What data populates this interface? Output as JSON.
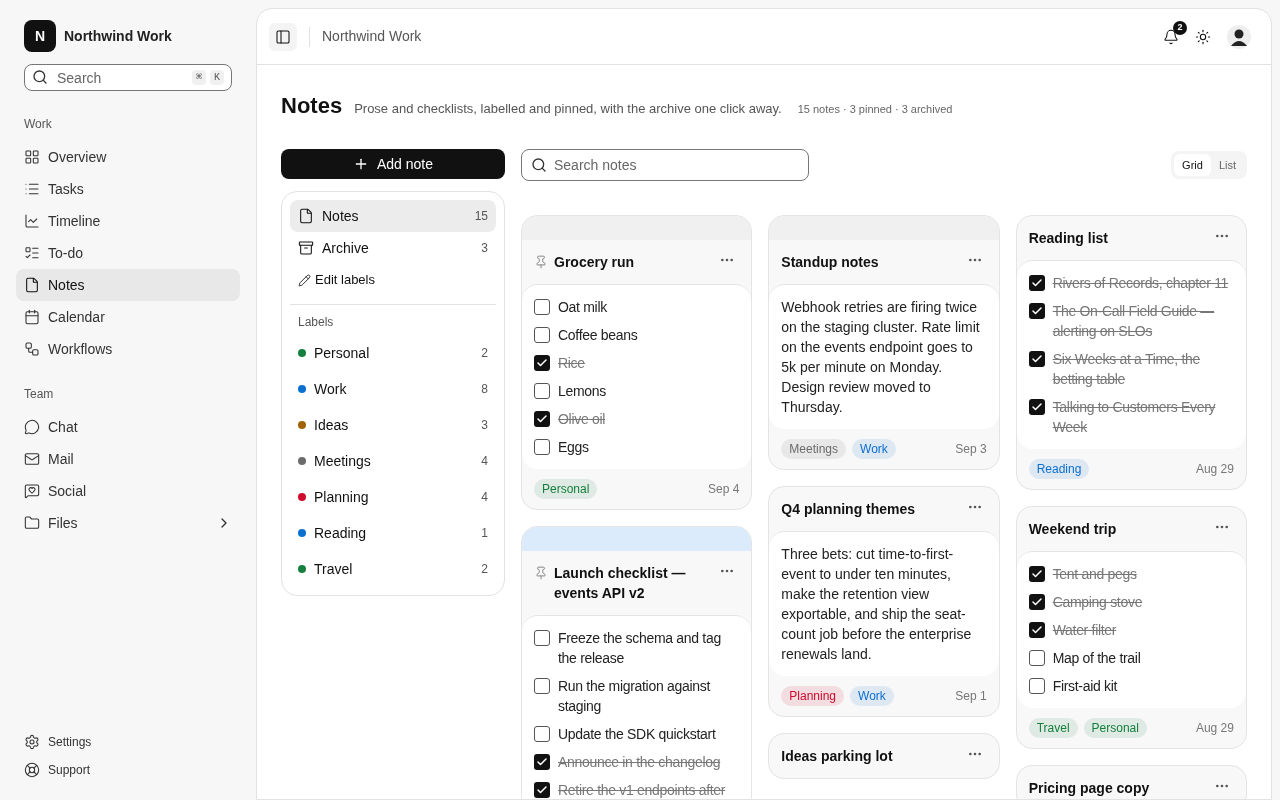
{
  "workspace": {
    "logo_letter": "N",
    "name": "Northwind Work"
  },
  "sidebar": {
    "search": {
      "placeholder": "Search",
      "shortcut": [
        "⌘",
        "K"
      ]
    },
    "sections": [
      {
        "title": "Work",
        "items": [
          {
            "label": "Overview",
            "selected": false
          },
          {
            "label": "Tasks",
            "selected": false
          },
          {
            "label": "Timeline",
            "selected": false
          },
          {
            "label": "To-do",
            "selected": false
          },
          {
            "label": "Notes",
            "selected": true
          },
          {
            "label": "Calendar",
            "selected": false
          },
          {
            "label": "Workflows",
            "selected": false
          }
        ]
      },
      {
        "title": "Team",
        "items": [
          {
            "label": "Chat",
            "selected": false
          },
          {
            "label": "Mail",
            "selected": false
          },
          {
            "label": "Social",
            "selected": false
          },
          {
            "label": "Files",
            "selected": false,
            "expanded": false
          }
        ]
      }
    ],
    "footer": [
      {
        "label": "Settings"
      },
      {
        "label": "Support"
      }
    ]
  },
  "header": {
    "breadcrumb": "Northwind Work",
    "notifications": "2"
  },
  "page": {
    "title": "Notes",
    "subtitle": "Prose and checklists, labelled and pinned, with the archive one click away.",
    "stats": "15 notes · 3 pinned · 3 archived"
  },
  "add_button": "Add note",
  "search": {
    "placeholder": "Search notes"
  },
  "view_toggle": [
    {
      "label": "Grid",
      "selected": true
    },
    {
      "label": "List",
      "selected": false
    }
  ],
  "filters": [
    {
      "label": "Notes",
      "count": "15",
      "selected": true
    },
    {
      "label": "Archive",
      "count": "3",
      "selected": false
    }
  ],
  "edit_labels": "Edit labels",
  "labels_title": "Labels",
  "labels": [
    {
      "name": "Personal",
      "count": "2",
      "color": "#15803d"
    },
    {
      "name": "Work",
      "count": "8",
      "color": "#0b6fd0"
    },
    {
      "name": "Ideas",
      "count": "3",
      "color": "#a16207"
    },
    {
      "name": "Meetings",
      "count": "4",
      "color": "#6b6b6b"
    },
    {
      "name": "Planning",
      "count": "4",
      "color": "#d00a2c"
    },
    {
      "name": "Reading",
      "count": "1",
      "color": "#0b6fd0"
    },
    {
      "name": "Travel",
      "count": "2",
      "color": "#15803d"
    }
  ],
  "columns": [
    [
      {
        "title": "Grocery run",
        "pinned": true,
        "color": "#f0f0f0",
        "kind": "checklist",
        "items": [
          {
            "text": "Oat milk",
            "checked": false
          },
          {
            "text": "Coffee beans",
            "checked": false
          },
          {
            "text": "Rice",
            "checked": true
          },
          {
            "text": "Lemons",
            "checked": false
          },
          {
            "text": "Olive oil",
            "checked": true
          },
          {
            "text": "Eggs",
            "checked": false
          }
        ],
        "tags": [
          {
            "label": "Personal",
            "color": "#15803d"
          }
        ],
        "date": "Sep 4"
      },
      {
        "title": "Launch checklist — events API v2",
        "pinned": true,
        "color": "#dcebfc",
        "kind": "checklist",
        "items": [
          {
            "text": "Freeze the schema and tag the release",
            "checked": false
          },
          {
            "text": "Run the migration against staging",
            "checked": false
          },
          {
            "text": "Update the SDK quickstart",
            "checked": false
          },
          {
            "text": "Announce in the changelog",
            "checked": true
          },
          {
            "text": "Retire the v1 endpoints after",
            "checked": true
          }
        ]
      }
    ],
    [
      {
        "title": "Standup notes",
        "pinned": false,
        "color": "#f0f0f0",
        "kind": "text",
        "text": "Webhook retries are firing twice on the staging cluster. Rate limit on the events endpoint goes to 5k per minute on Monday. Design review moved to Thursday.",
        "tags": [
          {
            "label": "Meetings",
            "color": "#6b6b6b"
          },
          {
            "label": "Work",
            "color": "#0b6fd0"
          }
        ],
        "date": "Sep 3"
      },
      {
        "title": "Q4 planning themes",
        "pinned": false,
        "kind": "text",
        "text": "Three bets: cut time-to-first-event to under ten minutes, make the retention view exportable, and ship the seat-count job before the enterprise renewals land.",
        "tags": [
          {
            "label": "Planning",
            "color": "#d00a2c"
          },
          {
            "label": "Work",
            "color": "#0b6fd0"
          }
        ],
        "date": "Sep 1"
      },
      {
        "title": "Ideas parking lot",
        "pinned": false
      }
    ],
    [
      {
        "title": "Reading list",
        "pinned": false,
        "kind": "checklist",
        "items": [
          {
            "text": "Rivers of Records, chapter 11",
            "checked": true
          },
          {
            "text": "The On-Call Field Guide — alerting on SLOs",
            "checked": true
          },
          {
            "text": "Six Weeks at a Time, the betting table",
            "checked": true
          },
          {
            "text": "Talking to Customers Every Week",
            "checked": true
          }
        ],
        "tags": [
          {
            "label": "Reading",
            "color": "#0b6fd0"
          }
        ],
        "date": "Aug 29"
      },
      {
        "title": "Weekend trip",
        "pinned": false,
        "kind": "checklist",
        "items": [
          {
            "text": "Tent and pegs",
            "checked": true
          },
          {
            "text": "Camping stove",
            "checked": true
          },
          {
            "text": "Water filter",
            "checked": true
          },
          {
            "text": "Map of the trail",
            "checked": false
          },
          {
            "text": "First-aid kit",
            "checked": false
          }
        ],
        "tags": [
          {
            "label": "Travel",
            "color": "#15803d"
          },
          {
            "label": "Personal",
            "color": "#15803d"
          }
        ],
        "date": "Aug 29"
      },
      {
        "title": "Pricing page copy",
        "pinned": false
      }
    ]
  ]
}
